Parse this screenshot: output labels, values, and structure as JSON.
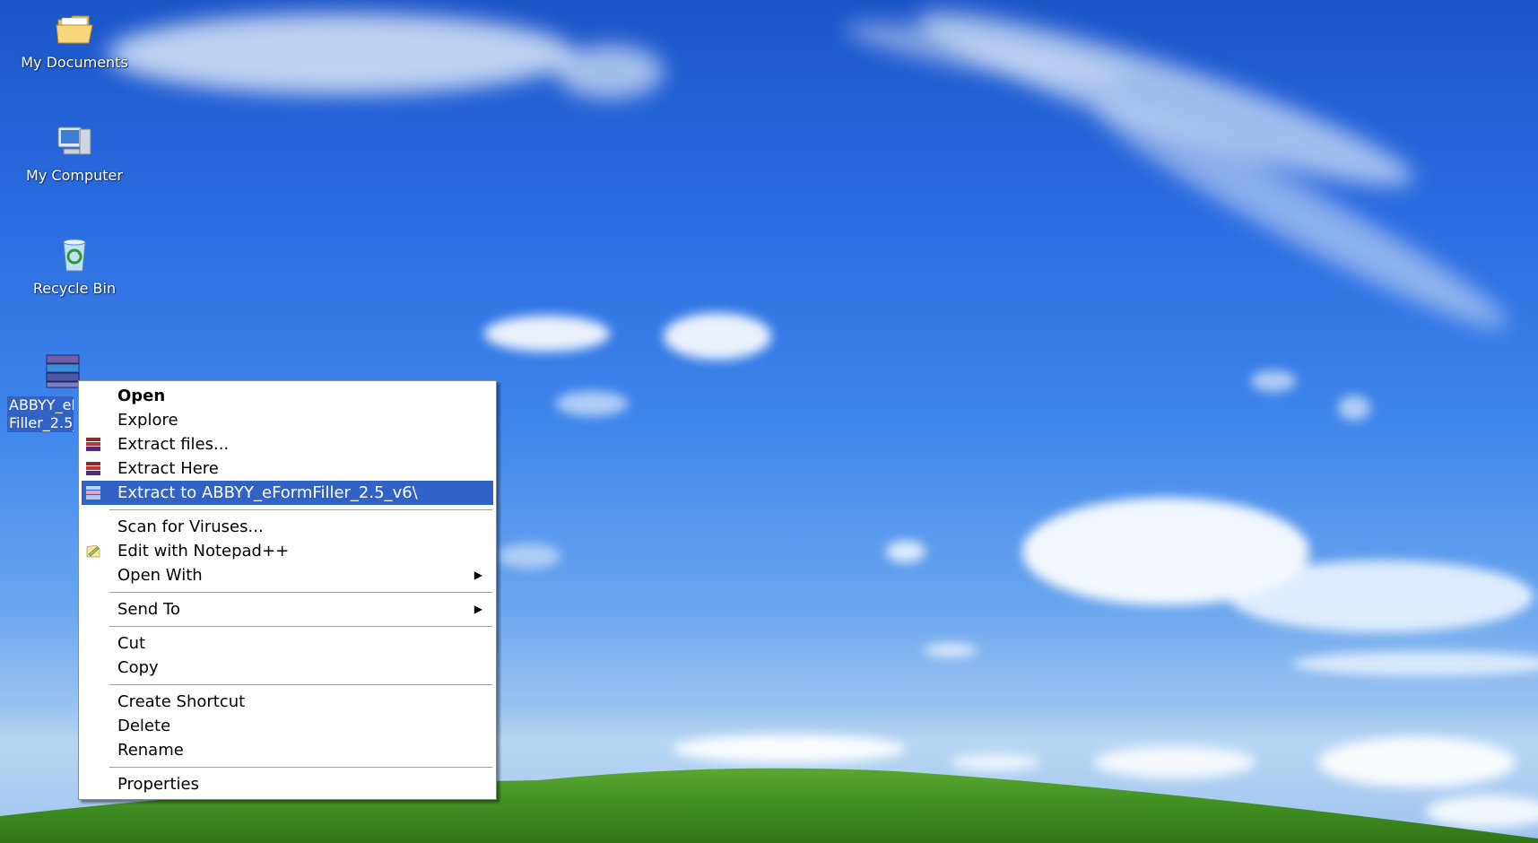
{
  "desktop": {
    "icons": [
      {
        "label": "My Documents",
        "icon": "folder-icon"
      },
      {
        "label": "My Computer",
        "icon": "computer-icon"
      },
      {
        "label": "Recycle Bin",
        "icon": "recycle-bin-icon"
      },
      {
        "label": "ABBYY_eForm Filler_2.5_v6",
        "icon": "winrar-archive-icon",
        "selected": true
      }
    ]
  },
  "context_menu": {
    "items": [
      {
        "label": "Open",
        "bold": true
      },
      {
        "label": "Explore"
      },
      {
        "label": "Extract files...",
        "icon": "winrar-icon"
      },
      {
        "label": "Extract Here",
        "icon": "winrar-icon"
      },
      {
        "label": "Extract to ABBYY_eFormFiller_2.5_v6\\",
        "icon": "winrar-extract-icon",
        "highlighted": true
      },
      {
        "label": "Scan for Viruses..."
      },
      {
        "label": "Edit with Notepad++",
        "icon": "notepad-plus-plus-icon"
      },
      {
        "label": "Open With",
        "submenu": true
      },
      {
        "label": "Send To",
        "submenu": true
      },
      {
        "label": "Cut"
      },
      {
        "label": "Copy"
      },
      {
        "label": "Create Shortcut"
      },
      {
        "label": "Delete"
      },
      {
        "label": "Rename"
      },
      {
        "label": "Properties"
      }
    ]
  },
  "colors": {
    "selection": "#3162c5",
    "sky": "#2a6be0",
    "grass": "#4a9a2a"
  }
}
